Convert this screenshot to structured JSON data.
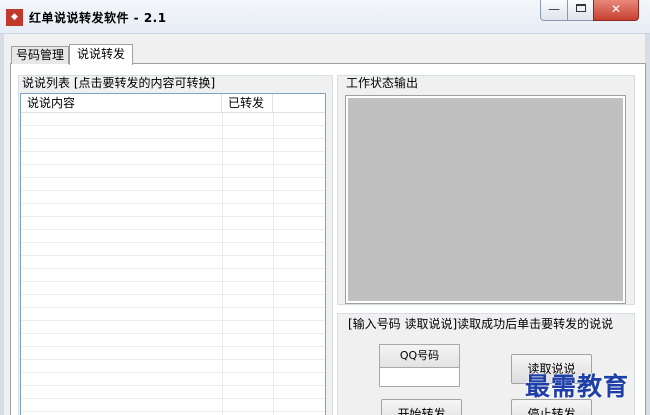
{
  "window": {
    "title": "红单说说转发软件 - 2.1",
    "icon_name": "app-logo-icon",
    "minimize_glyph": "—",
    "close_glyph": "✕"
  },
  "tabs": [
    {
      "label": "号码管理",
      "active": false
    },
    {
      "label": "说说转发",
      "active": true
    }
  ],
  "list_group": {
    "label": "说说列表 [点击要转发的内容可转换]",
    "columns": [
      "说说内容",
      "已转发",
      ""
    ]
  },
  "output_group": {
    "label": "工作状态输出"
  },
  "control_group": {
    "label": "[输入号码 读取说说]读取成功后单击要转发的说说",
    "qq_label": "QQ号码",
    "qq_value": "",
    "read_button": "读取说说",
    "start_button": "开始转发",
    "stop_button": "停止转发"
  },
  "watermark": "最需教育",
  "colors": {
    "close_button": "#c74131",
    "output_bg": "#c0c0c0",
    "watermark": "#1f3fa8"
  }
}
